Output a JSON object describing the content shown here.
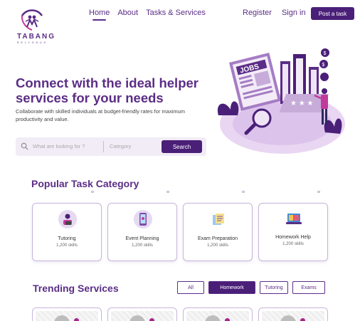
{
  "brand": {
    "name": "TABANG",
    "tagline": "R E L Y  O N  U S"
  },
  "nav": {
    "home": "Home",
    "about": "About",
    "tasks": "Tasks & Services"
  },
  "auth": {
    "register": "Register",
    "signin": "Sign in",
    "post": "Post a task"
  },
  "hero": {
    "title": "Connect with the ideal helper services for your needs",
    "subtitle": "Collaborate with skilled individuals at budget-friendly rates for maximum productivity and value.",
    "illustration_label": "JOBS"
  },
  "search": {
    "placeholder": "What are looking for ?",
    "category_placeholder": "Category",
    "button": "Search"
  },
  "popular": {
    "title": "Popular Task Category",
    "categories": [
      {
        "name": "Tutoring",
        "count": "1,200 skills",
        "icon": "tutor-icon"
      },
      {
        "name": "Event Planning",
        "count": "1,200 skills",
        "icon": "phone-event-icon"
      },
      {
        "name": "Exam Preparation",
        "count": "1,200 skills",
        "icon": "exam-icon"
      },
      {
        "name": "Homework Help",
        "count": "1,200 skills",
        "icon": "laptop-homework-icon"
      }
    ]
  },
  "trending": {
    "title": "Trending Services",
    "filters": [
      {
        "label": "All",
        "active": false
      },
      {
        "label": "Homework",
        "active": true
      },
      {
        "label": "Tutoring",
        "active": false
      },
      {
        "label": "Exams",
        "active": false
      }
    ]
  },
  "colors": {
    "primary": "#5b2d86",
    "button": "#4a1f78",
    "accent": "#a8238a",
    "soft": "#f1ecf6"
  }
}
